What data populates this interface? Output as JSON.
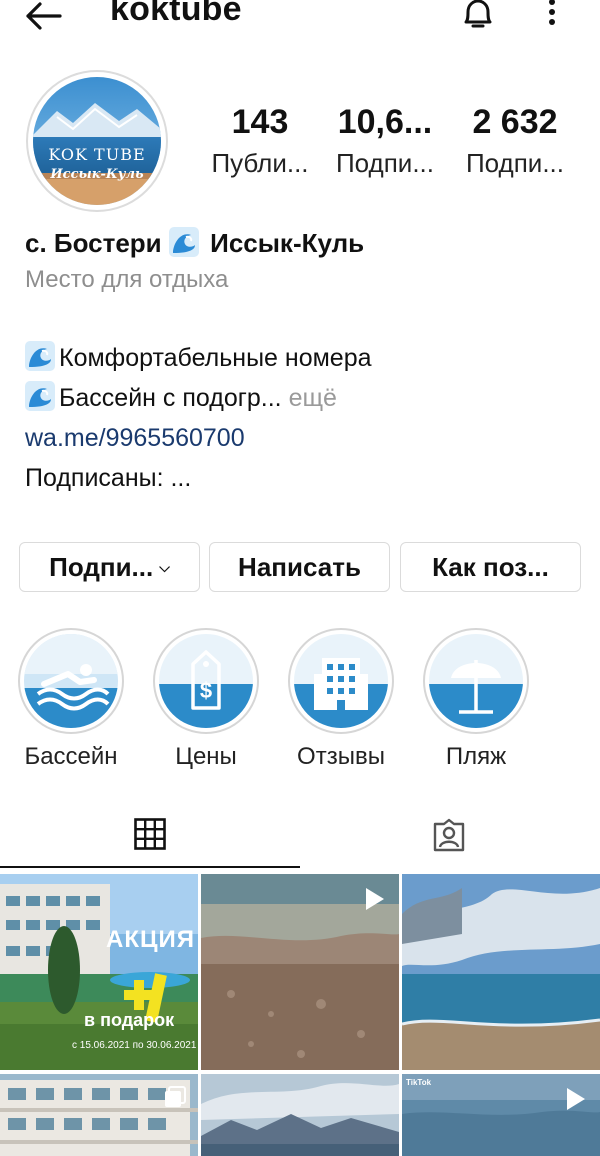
{
  "header": {
    "username": "koktube",
    "back_icon": "arrow-left-icon",
    "bell_icon": "bell-icon",
    "more_icon": "more-vertical-icon"
  },
  "avatar": {
    "line1": "KOK TUBE",
    "line2": "Иссык-Куль"
  },
  "stats": [
    {
      "value": "143",
      "label": "Публи..."
    },
    {
      "value": "10,6...",
      "label": "Подпи..."
    },
    {
      "value": "2 632",
      "label": "Подпи..."
    }
  ],
  "bio": {
    "name_part1": "с. Бостери",
    "name_part2": "Иссык-Куль",
    "category": "Место для отдыха",
    "line1": "Комфортабельные номера",
    "line2": "Бассейн с подогр...",
    "line2_more": " ещё",
    "link": "wa.me/9965560700",
    "followed_by": "Подписаны: ..."
  },
  "buttons": {
    "follow": "Подпи...",
    "message": "Написать",
    "how_to": "Как поз..."
  },
  "highlights": [
    {
      "label": "Бассейн",
      "icon": "swimmer-icon"
    },
    {
      "label": "Цены",
      "icon": "price-tag-icon"
    },
    {
      "label": "Отзывы",
      "icon": "building-icon"
    },
    {
      "label": "Пляж",
      "icon": "beach-umbrella-icon"
    }
  ],
  "tabs": [
    {
      "name": "posts",
      "icon": "grid-icon",
      "active": true
    },
    {
      "name": "tagged",
      "icon": "tagged-person-icon",
      "active": false
    }
  ],
  "posts": [
    {
      "title": "АКЦИЯ",
      "badge": "+1",
      "subtitle": "в подарок",
      "date": "с 15.06.2021 по 30.06.2021",
      "type": "image"
    },
    {
      "type": "video"
    },
    {
      "type": "image"
    },
    {
      "type": "carousel"
    },
    {
      "type": "image"
    },
    {
      "type": "video",
      "overlay": "TikTok"
    }
  ],
  "colors": {
    "link": "#1a3a6e",
    "muted": "#8e8e8e",
    "border": "#dbdbdb"
  }
}
